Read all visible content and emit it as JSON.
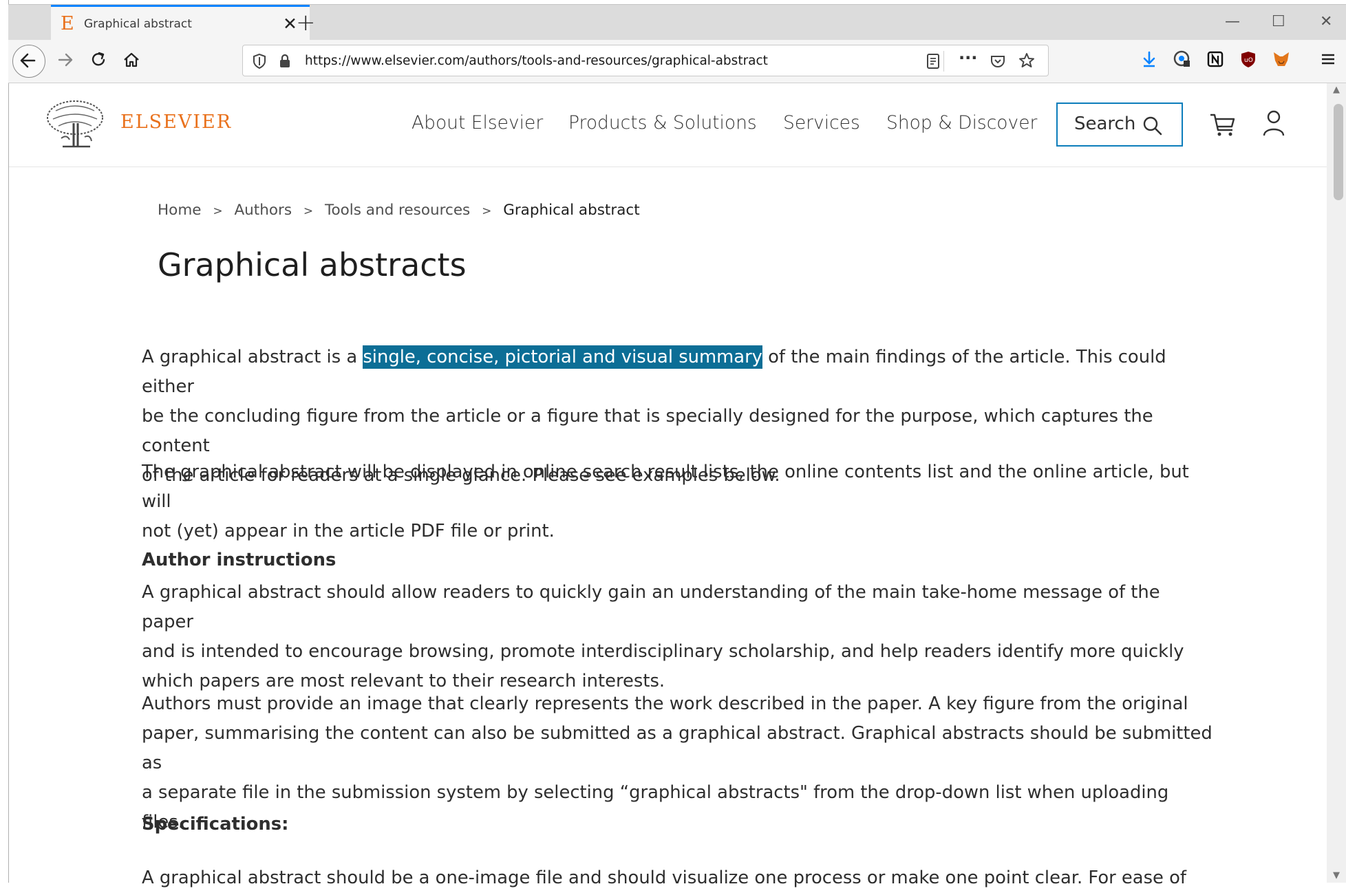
{
  "browser": {
    "tab_title": "Graphical abstract",
    "url": "https://www.elsevier.com/authors/tools-and-resources/graphical-abstract",
    "accent_color": "#0a84ff"
  },
  "site": {
    "logo_text": "ELSEVIER",
    "nav": [
      "About Elsevier",
      "Products & Solutions",
      "Services",
      "Shop & Discover"
    ],
    "search_label": "Search",
    "brand_color": "#e9711c"
  },
  "breadcrumb": {
    "items": [
      "Home",
      "Authors",
      "Tools and resources"
    ],
    "separator": ">",
    "current": "Graphical abstract"
  },
  "content": {
    "title": "Graphical abstracts",
    "p1_line1_before": "A graphical abstract is a ",
    "p1_highlight": "single, concise, pictorial and visual summary",
    "p1_line1_after": " of the main findings of the article. This could either",
    "p1_line2": "be the concluding figure from the article or a figure that is specially designed for the purpose, which captures the content",
    "p1_line3": "of the article for readers at a single glance. Please see examples below.",
    "p2_line1": "The graphical abstract will be displayed in online search result lists, the online contents list and the online article, but will",
    "p2_line2": "not (yet) appear in the article PDF file or print.",
    "heading_author": "Author instructions",
    "p3_line1": "A graphical abstract should allow readers to quickly gain an understanding of the main take-home message of the paper",
    "p3_line2": "and is intended to encourage browsing, promote interdisciplinary scholarship, and help readers identify more quickly",
    "p3_line3": "which papers are most relevant to their research interests.",
    "p4_line1": "Authors must provide an image that clearly represents the work described in the paper. A key figure from the original",
    "p4_line2": "paper, summarising the content can also be submitted as a graphical abstract. Graphical abstracts should be submitted as",
    "p4_line3": "a separate file in the submission system by selecting “graphical abstracts\" from the drop-down list when uploading files.",
    "heading_specs": "Specifications:",
    "p5_line1": "A graphical abstract should be a one-image file and should visualize one process or make one point clear. For ease of"
  }
}
